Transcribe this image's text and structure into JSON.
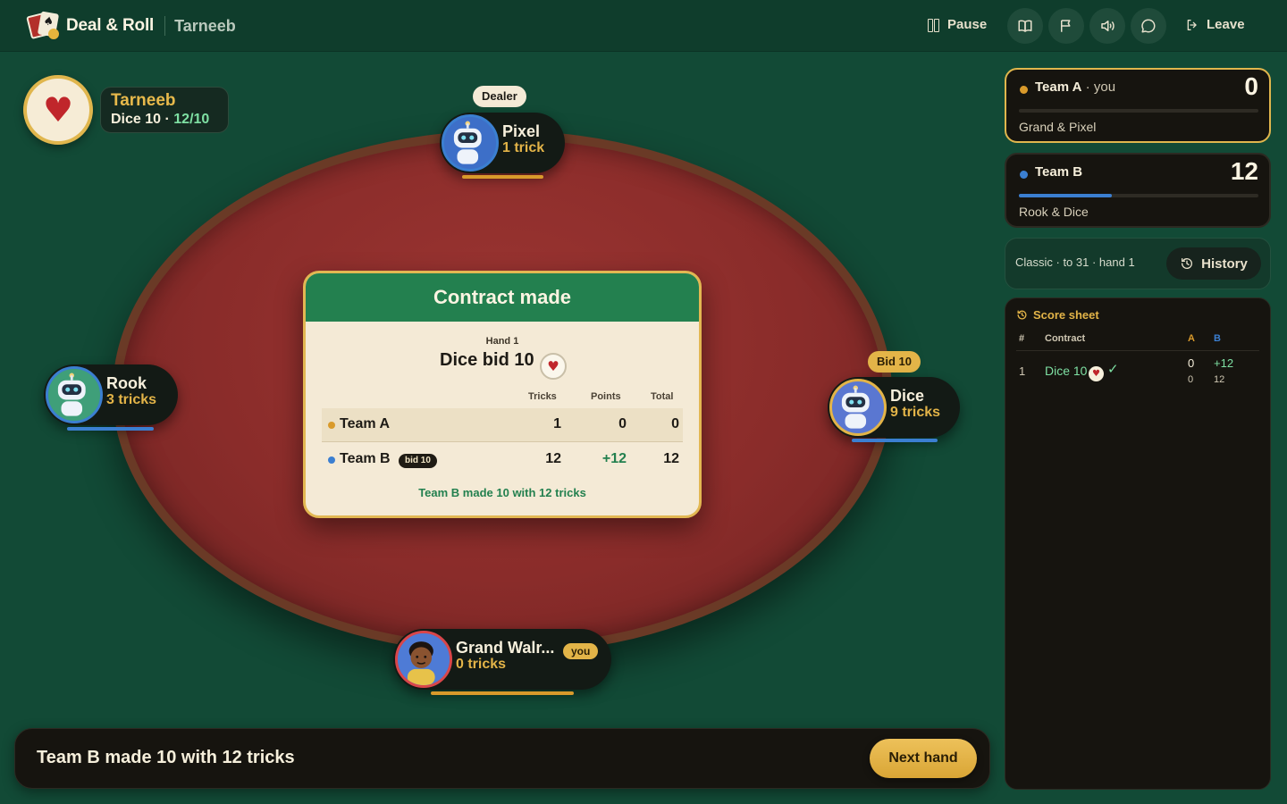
{
  "header": {
    "brand": "Deal & Roll",
    "game": "Tarneeb",
    "pause_label": "Pause",
    "leave_label": "Leave",
    "icons": [
      "book-icon",
      "flag-icon",
      "sound-icon",
      "chat-icon"
    ]
  },
  "trump": {
    "suit_symbol": "♥",
    "suit_color": "#c0262b",
    "game_name": "Tarneeb",
    "bidder_line": "Dice 10 · ",
    "tricks_of_bid": "12/10"
  },
  "seats": {
    "top": {
      "name": "Pixel",
      "tricks": "1 trick",
      "tag": "Dealer"
    },
    "left": {
      "name": "Rook",
      "tricks": "3 tricks"
    },
    "right": {
      "name": "Dice",
      "tricks": "9 tricks",
      "tag": "Bid 10"
    },
    "bottom": {
      "name": "Grand Walr...",
      "tricks": "0 tricks",
      "tag": "you"
    }
  },
  "result_card": {
    "title": "Contract made",
    "hand_label": "Hand 1",
    "contract": "Dice bid 10",
    "suit_symbol": "♥",
    "columns": [
      "Tricks",
      "Points",
      "Total"
    ],
    "rows": [
      {
        "team": "Team A",
        "dot_color": "#d99a2b",
        "tricks": "1",
        "points": "0",
        "total": "0"
      },
      {
        "team": "Team B",
        "dot_color": "#3b7fd1",
        "bid_tag": "bid 10",
        "tricks": "12",
        "points": "+12",
        "total": "12"
      }
    ],
    "footer": "Team B made 10 with 12 tricks"
  },
  "bottom_bar": {
    "message": "Team B made 10 with 12 tricks",
    "next_label": "Next hand"
  },
  "teams": [
    {
      "name": "Team A",
      "you_suffix": " · you",
      "score": "0",
      "members": "Grand & Pixel",
      "color": "#d99a2b",
      "progress": 0.0,
      "active": true
    },
    {
      "name": "Team B",
      "you_suffix": "",
      "score": "12",
      "members": "Rook & Dice",
      "color": "#3b7fd1",
      "progress": 0.387,
      "active": false
    }
  ],
  "mode": {
    "description": "Classic · to 31 · hand 1",
    "history_label": "History"
  },
  "score_sheet": {
    "title": "Score sheet",
    "headers": {
      "num": "#",
      "contract": "Contract",
      "a": "A",
      "b": "B"
    },
    "rows": [
      {
        "num": "1",
        "contract": "Dice 10",
        "suit_symbol": "♥",
        "check": "✓",
        "a_points": "0",
        "b_points": "+12",
        "a_total": "0",
        "b_total": "12"
      }
    ]
  },
  "colors": {
    "accent_gold": "#e3b448",
    "felt": "#8a2c2a",
    "team_a": "#d99a2b",
    "team_b": "#3b7fd1",
    "success_green": "#23804f"
  }
}
